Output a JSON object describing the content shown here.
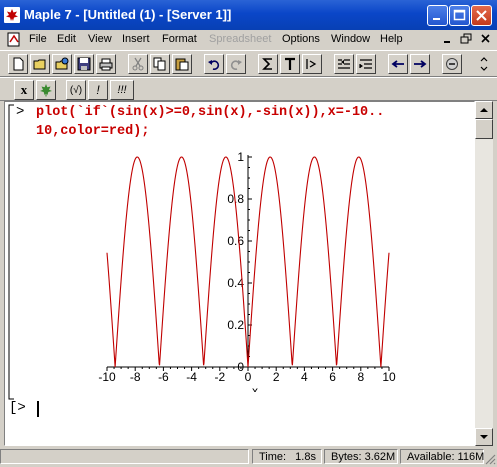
{
  "window": {
    "title": "Maple 7  - [Untitled (1) - [Server 1]]"
  },
  "menubar": {
    "items": [
      {
        "label": "File",
        "enabled": true
      },
      {
        "label": "Edit",
        "enabled": true
      },
      {
        "label": "View",
        "enabled": true
      },
      {
        "label": "Insert",
        "enabled": true
      },
      {
        "label": "Format",
        "enabled": true
      },
      {
        "label": "Spreadsheet",
        "enabled": false
      },
      {
        "label": "Options",
        "enabled": true
      },
      {
        "label": "Window",
        "enabled": true
      },
      {
        "label": "Help",
        "enabled": true
      }
    ]
  },
  "toolbar": {
    "row1_icons": [
      "new-icon",
      "open-icon",
      "open-url-icon",
      "save-icon",
      "print-icon",
      "cut-icon",
      "copy-icon",
      "paste-icon",
      "undo-icon",
      "redo-icon",
      "sigma-icon",
      "text-icon",
      "prompt-icon",
      "collapse-section-icon",
      "expand-section-icon",
      "back-icon",
      "forward-icon",
      "stop-icon"
    ],
    "row2": {
      "math_label": "x",
      "maple_leaf_icon": "maple-leaf-icon",
      "check_label": "(√)",
      "exec_label": "!",
      "exec_all_label": "!!!"
    }
  },
  "worksheet": {
    "prompt": "[>",
    "command_line1": "plot(`if`(sin(x)>=0,sin(x),-sin(x)),x=-10..",
    "command_line2": "10,color=red);",
    "empty_prompt": "[>"
  },
  "chart_data": {
    "type": "line",
    "function": "if(sin(x)>=0, sin(x), -sin(x))",
    "title": "",
    "xlabel": "x",
    "ylabel": "",
    "xlim": [
      -10,
      10
    ],
    "ylim": [
      0,
      1
    ],
    "x_ticks": [
      "-10",
      "-8",
      "-6",
      "-4",
      "-2",
      "0",
      "2",
      "4",
      "6",
      "8",
      "10"
    ],
    "x_tick_values": [
      -10,
      -8,
      -6,
      -4,
      -2,
      0,
      2,
      4,
      6,
      8,
      10
    ],
    "y_ticks": [
      "0",
      "0.2",
      "0.4",
      "0.6",
      "0.8",
      "1"
    ],
    "y_tick_values": [
      0,
      0.2,
      0.4,
      0.6,
      0.8,
      1
    ],
    "series": [
      {
        "color": "#c00000",
        "x": [
          -10,
          -9.5,
          -9,
          -8.5,
          -8,
          -7.5,
          -7,
          -6.5,
          -6,
          -5.5,
          -5,
          -4.5,
          -4,
          -3.5,
          -3,
          -2.5,
          -2,
          -1.5,
          -1,
          -0.5,
          0,
          0.5,
          1,
          1.5,
          2,
          2.5,
          3,
          3.5,
          4,
          4.5,
          5,
          5.5,
          6,
          6.5,
          7,
          7.5,
          8,
          8.5,
          9,
          9.5,
          10
        ],
        "y": [
          0.544,
          0.075,
          0.412,
          0.798,
          0.989,
          0.938,
          0.657,
          0.215,
          0.279,
          0.706,
          0.959,
          0.978,
          0.757,
          0.351,
          0.141,
          0.598,
          0.909,
          0.997,
          0.841,
          0.479,
          0,
          0.479,
          0.841,
          0.997,
          0.909,
          0.598,
          0.141,
          0.351,
          0.757,
          0.978,
          0.959,
          0.706,
          0.279,
          0.215,
          0.657,
          0.938,
          0.989,
          0.798,
          0.412,
          0.075,
          0.544
        ]
      }
    ],
    "color": "#c00000",
    "grid": false
  },
  "statusbar": {
    "time_label": "Time:",
    "time_value": "1.8s",
    "bytes_label": "Bytes: 3.62M",
    "available_label": "Available: 116M"
  }
}
